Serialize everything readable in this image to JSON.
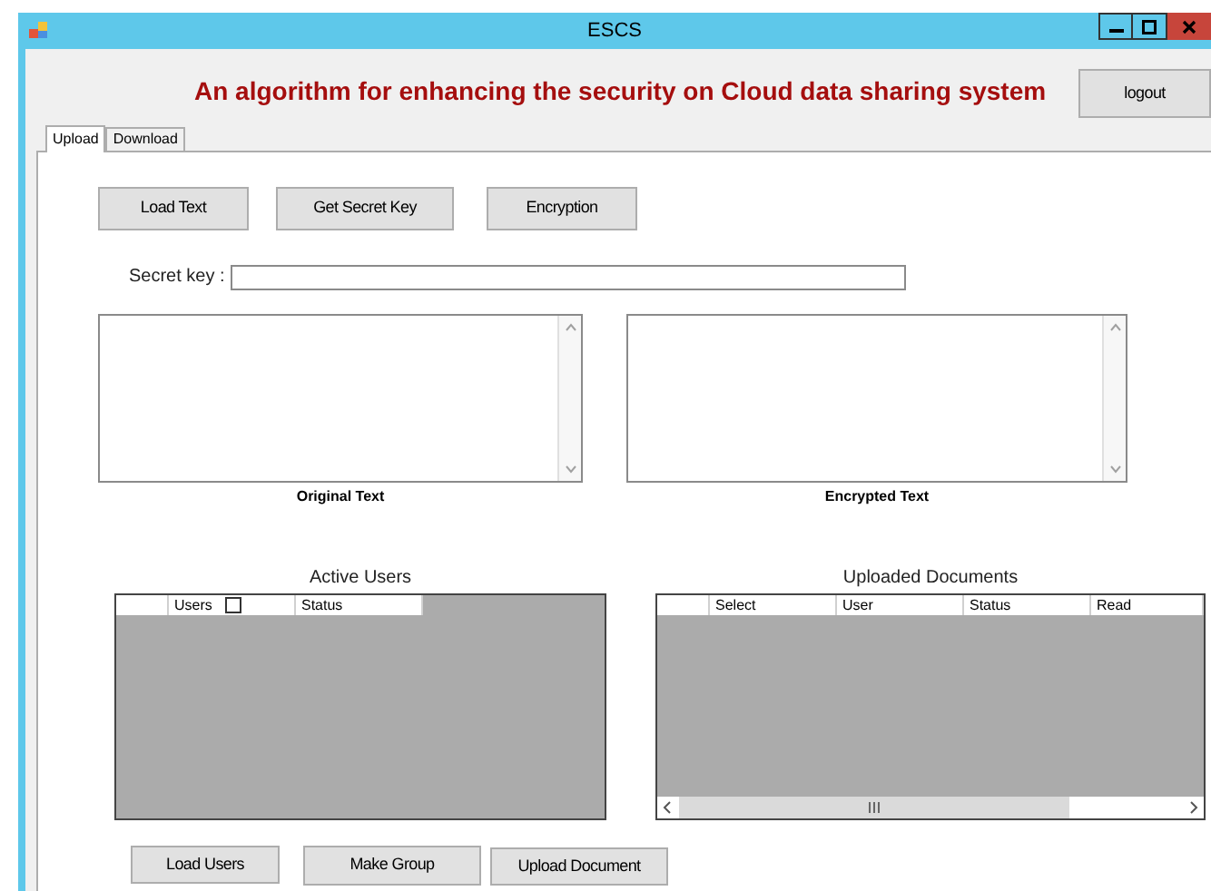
{
  "window": {
    "title": "ESCS"
  },
  "header": {
    "title": "An algorithm for enhancing the security on Cloud data sharing system",
    "logout_button": "logout"
  },
  "tabs": [
    {
      "label": "Upload",
      "selected": true
    },
    {
      "label": "Download",
      "selected": false
    }
  ],
  "action_buttons": [
    "Load Text",
    "Get Secret Key",
    "Encryption"
  ],
  "secret_key": {
    "label": "Secret key :"
  },
  "text_panels": [
    {
      "caption": "Original Text"
    },
    {
      "caption": "Encrypted Text"
    }
  ],
  "active_users": {
    "title": "Active Users",
    "columns": [
      "Users",
      "Status"
    ],
    "select_all_checked": false
  },
  "uploaded_documents": {
    "title": "Uploaded Documents",
    "columns": [
      "Select",
      "User",
      "Status",
      "Read"
    ]
  },
  "bottom_buttons": [
    "Load Users",
    "Make Group",
    "Upload Document"
  ]
}
